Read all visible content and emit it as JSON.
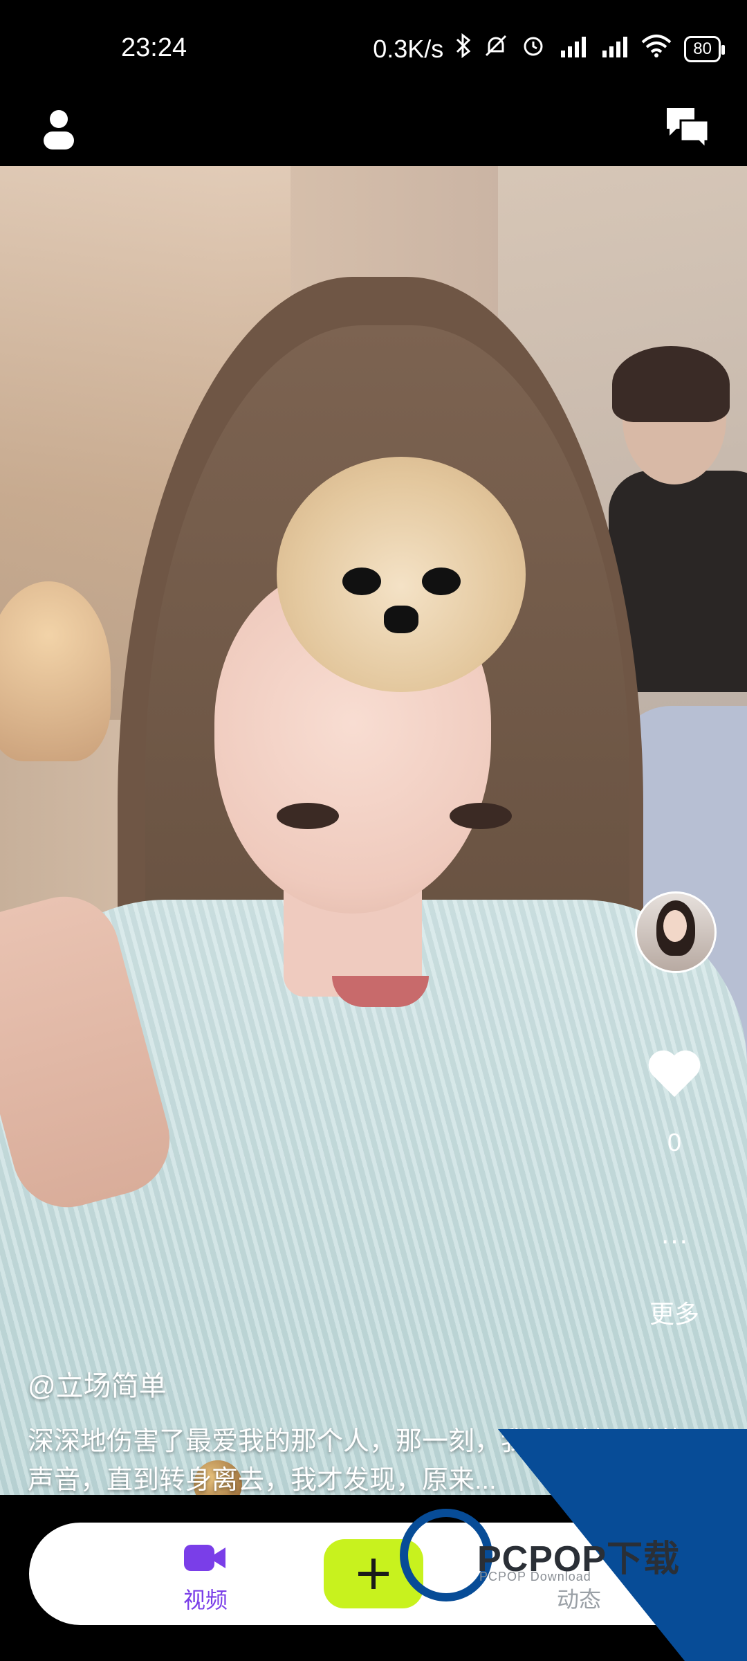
{
  "status_bar": {
    "time": "23:24",
    "network_speed": "0.3K/s",
    "battery": "80",
    "icons": [
      "bluetooth-icon",
      "mute-icon",
      "alarm-icon",
      "signal-hd-icon",
      "signal-hd-icon",
      "wifi-icon",
      "battery-icon"
    ]
  },
  "top_bar": {
    "left_icon": "person-icon",
    "right_icon": "chat-bubbles-icon"
  },
  "post": {
    "author": "@立场简单",
    "caption": "深深地伤害了最爱我的那个人，那一刻，我听到她心碎的声音，直到转身离去，我才发现，原来..."
  },
  "actions": {
    "like_count": "0",
    "more_glyph": "···",
    "more_label": "更多"
  },
  "bottom_nav": {
    "video_label": "视频",
    "plus_glyph": "+",
    "dynamics_label": "动态",
    "accent_color": "#7a3ee8",
    "plus_color": "#c8f21e"
  },
  "watermark": {
    "text": "PCPOP下载",
    "sub": "PCPOP Download"
  }
}
